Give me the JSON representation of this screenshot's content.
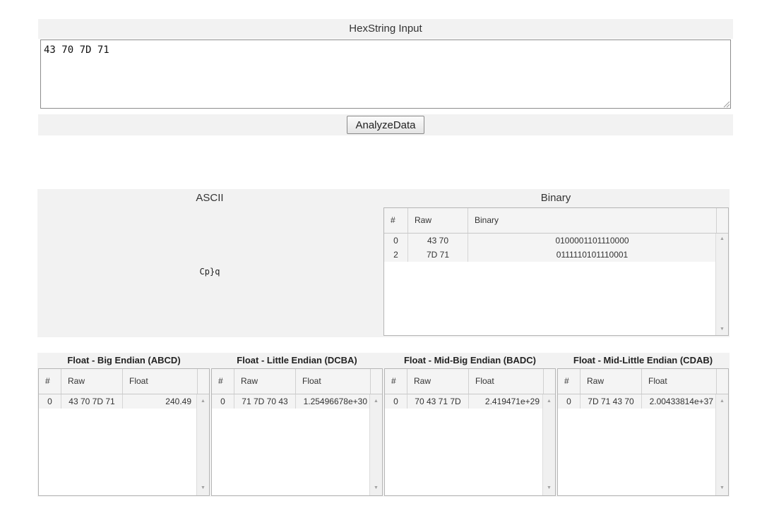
{
  "input": {
    "header": "HexString Input",
    "value": "43 70 7D 71",
    "analyze_label": "AnalyzeData"
  },
  "ascii": {
    "header": "ASCII",
    "text": "Cp}q"
  },
  "binary": {
    "header": "Binary",
    "columns": [
      "#",
      "Raw",
      "Binary"
    ],
    "rows": [
      {
        "index": "0",
        "raw": "43 70",
        "value": "0100001101110000"
      },
      {
        "index": "2",
        "raw": "7D 71",
        "value": "0111110101110001"
      }
    ]
  },
  "float_tables": [
    {
      "header": "Float - Big Endian (ABCD)",
      "columns": [
        "#",
        "Raw",
        "Float"
      ],
      "rows": [
        {
          "index": "0",
          "raw": "43 70 7D 71",
          "value": "240.49"
        }
      ]
    },
    {
      "header": "Float - Little Endian (DCBA)",
      "columns": [
        "#",
        "Raw",
        "Float"
      ],
      "rows": [
        {
          "index": "0",
          "raw": "71 7D 70 43",
          "value": "1.25496678e+30"
        }
      ]
    },
    {
      "header": "Float - Mid-Big Endian (BADC)",
      "columns": [
        "#",
        "Raw",
        "Float"
      ],
      "rows": [
        {
          "index": "0",
          "raw": "70 43 71 7D",
          "value": "2.419471e+29"
        }
      ]
    },
    {
      "header": "Float - Mid-Little Endian (CDAB)",
      "columns": [
        "#",
        "Raw",
        "Float"
      ],
      "rows": [
        {
          "index": "0",
          "raw": "7D 71 43 70",
          "value": "2.00433814e+37"
        }
      ]
    }
  ],
  "icons": {
    "scroll_up": "chevron-up-icon",
    "scroll_down": "chevron-down-icon",
    "resize": "resize-grip-icon"
  }
}
